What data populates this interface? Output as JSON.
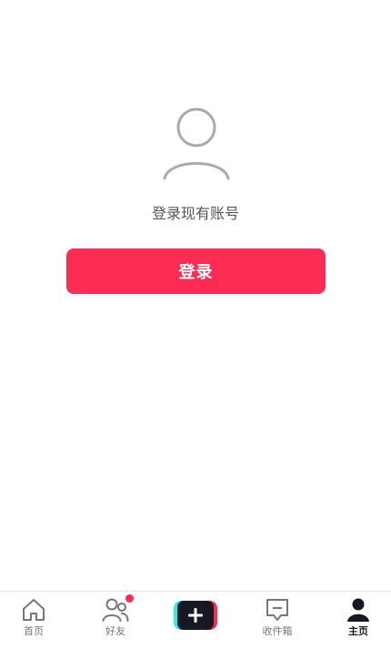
{
  "profile": {
    "prompt": "登录现有账号",
    "login_label": "登录",
    "avatar_icon": "user-outline-icon"
  },
  "tabbar": {
    "home_label": "首页",
    "friends_label": "好友",
    "create_icon": "plus-icon",
    "inbox_label": "收件箱",
    "profile_label": "主页",
    "active_tab": "主页"
  },
  "colors": {
    "brand": "#fe2c55",
    "accent_cyan": "#25f4ee",
    "text_dark": "#161823",
    "text_muted": "#777777"
  }
}
